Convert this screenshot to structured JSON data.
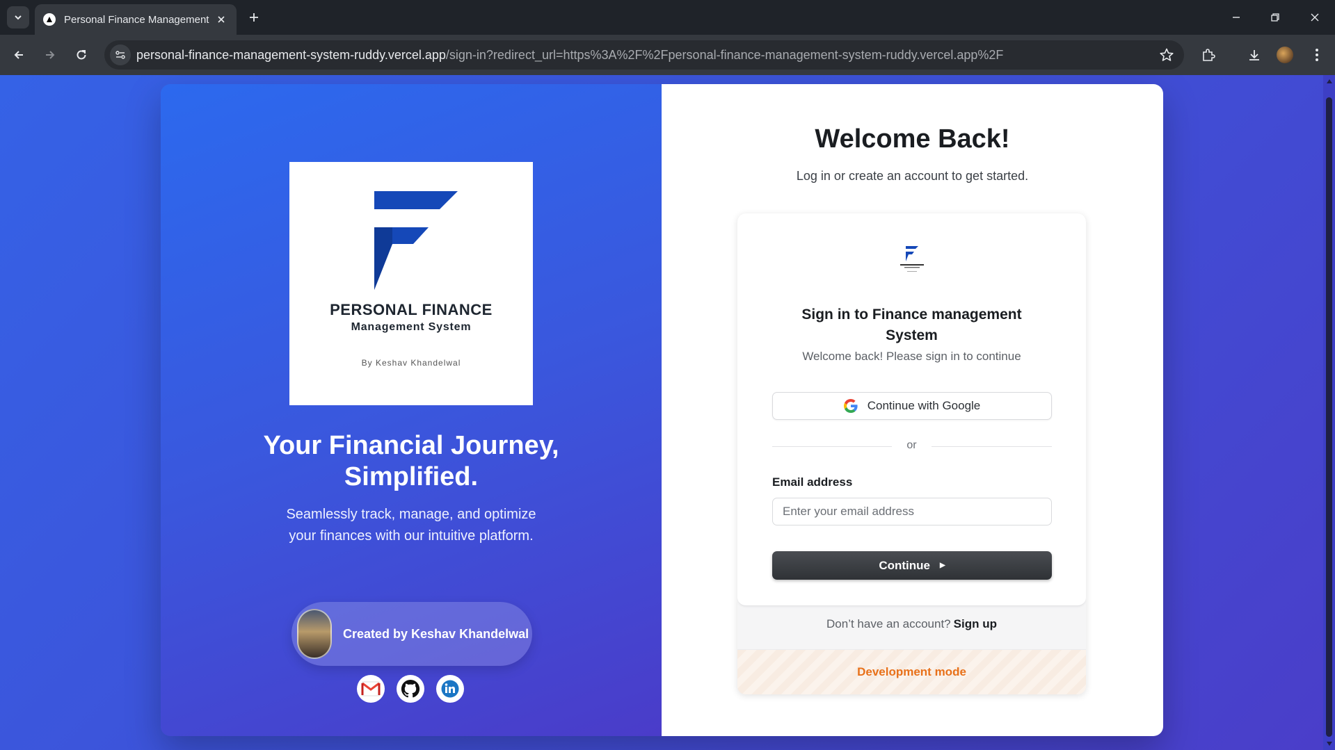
{
  "browser": {
    "tab_title": "Personal Finance Management",
    "url_host": "personal-finance-management-system-ruddy.vercel.app",
    "url_path": "/sign-in?redirect_url=https%3A%2F%2Fpersonal-finance-management-system-ruddy.vercel.app%2F"
  },
  "hero": {
    "logo_title": "PERSONAL FINANCE",
    "logo_subtitle": "Management System",
    "logo_byline": "By Keshav Khandelwal",
    "headline_line1": "Your Financial Journey,",
    "headline_line2": "Simplified.",
    "subline_line1": "Seamlessly track, manage, and optimize",
    "subline_line2": "your finances with our intuitive platform.",
    "creator_label": "Created by Keshav Khandelwal",
    "social": [
      "gmail-icon",
      "github-icon",
      "linkedin-icon"
    ]
  },
  "auth": {
    "welcome_title": "Welcome Back!",
    "welcome_sub": "Log in or create an account to get started.",
    "card_title": "Sign in to Finance management System",
    "card_sub": "Welcome back! Please sign in to continue",
    "google_label": "Continue with Google",
    "divider_label": "or",
    "email_label": "Email address",
    "email_placeholder": "Enter your email address",
    "email_value": "",
    "continue_label": "Continue",
    "footer_prompt": "Don’t have an account?",
    "signup_link": "Sign up",
    "dev_mode": "Development mode"
  },
  "colors": {
    "brand_blue": "#1548b8",
    "dev_orange": "#e8711a",
    "page_gradient_start": "#3562e6",
    "page_gradient_end": "#4a3ec9"
  }
}
